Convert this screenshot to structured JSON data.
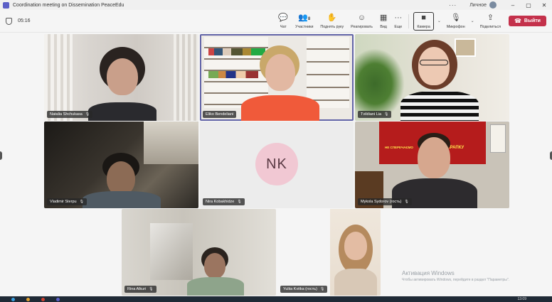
{
  "window": {
    "title": "Coordination meeting on Dissemination PeaceEdu",
    "profile_label": "Личное",
    "controls": {
      "more": "···",
      "minimize": "–",
      "maximize": "▢",
      "close": "✕"
    }
  },
  "toolbar": {
    "timer": "05:16",
    "buttons": [
      {
        "label": "Чат",
        "icon": "chat-icon"
      },
      {
        "label": "Участники",
        "icon": "participants-icon",
        "badge": "8"
      },
      {
        "label": "Поднять руку",
        "icon": "raise-hand-icon"
      },
      {
        "label": "Реагировать",
        "icon": "react-icon"
      },
      {
        "label": "Вид",
        "icon": "view-icon"
      },
      {
        "label": "Еще",
        "icon": "more-icon"
      }
    ],
    "camera_label": "Камера",
    "mic_label": "Микрофон",
    "share_label": "Поделиться",
    "leave_label": "Выйти"
  },
  "participants": [
    {
      "name": "Natalia Shchukasa",
      "muted": true
    },
    {
      "name": "Eliko Bendeliani",
      "muted": false,
      "active": true
    },
    {
      "name": "Tvildiani Lia",
      "muted": true
    },
    {
      "name": "Vladimir Sterpu",
      "muted": true
    },
    {
      "name": "Nira Kobakhidze",
      "muted": true,
      "initials": "NK"
    },
    {
      "name": "Mykola Sydorov (гость)",
      "muted": true
    },
    {
      "name": "Rina Alkuri",
      "muted": true
    },
    {
      "name": "Yuliia Kvitka (гость)",
      "muted": true
    }
  ],
  "banner_text": "НЕ СПЕРЕЧАЄМО",
  "banner_text2": "КРАПКУ",
  "activation": {
    "line1": "Активация Windows",
    "line2": "Чтобы активировать Windows, перейдите в раздел \"Параметры\"."
  },
  "taskbar": {
    "clock": "13:09"
  },
  "colors": {
    "accent": "#6264a7",
    "leave": "#c4314b",
    "nk_avatar": "#f1c8d3"
  }
}
